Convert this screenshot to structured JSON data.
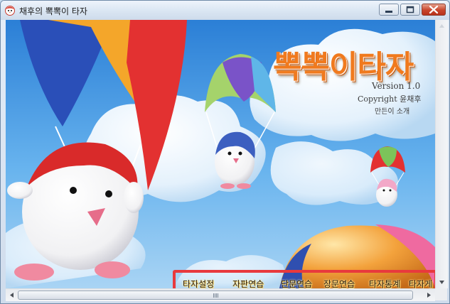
{
  "window": {
    "title": "채후의 뽁뽁이 타자"
  },
  "splash": {
    "logo_text": "뽁뽁이타자",
    "version": "Version 1.0",
    "copyright": "Copyright 윤채후",
    "maker": "만든이 소개"
  },
  "menu": {
    "items": [
      {
        "label": "타자설정"
      },
      {
        "label": "자판연습"
      },
      {
        "label": "단문연습"
      },
      {
        "label": "장문연습"
      },
      {
        "label": "타자통계"
      },
      {
        "label": "타자게"
      }
    ],
    "highlight_color": "#e8393d"
  },
  "colors": {
    "sky": "#4aa0e8",
    "logo": "#f07a1e",
    "close_button": "#c8452b"
  },
  "icons": {
    "app": "penguin-icon",
    "minimize": "minimize-icon",
    "maximize": "maximize-icon",
    "close": "close-icon"
  }
}
